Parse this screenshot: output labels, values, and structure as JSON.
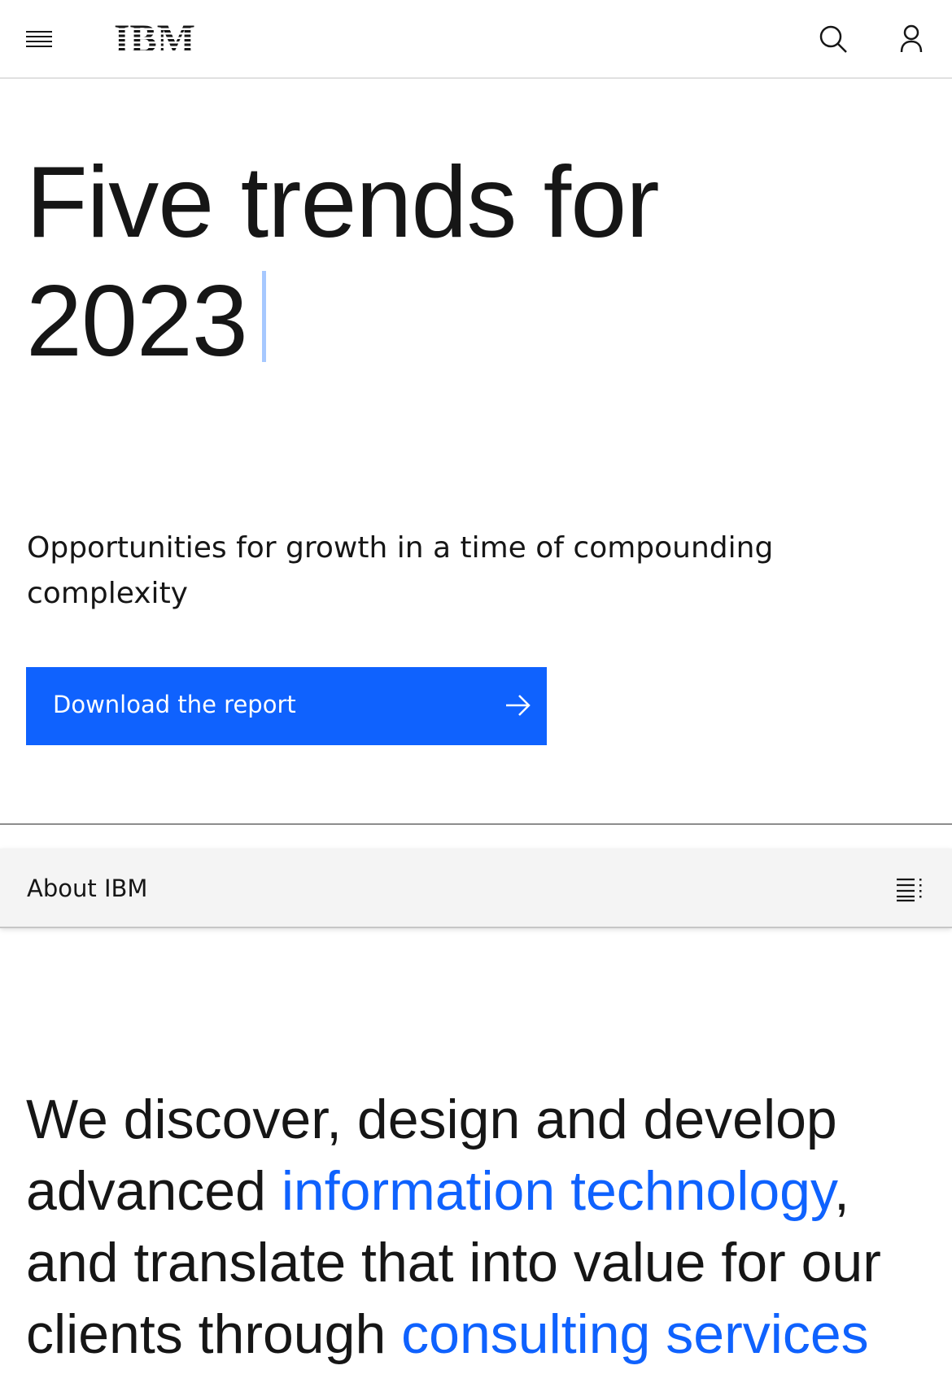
{
  "masthead": {
    "logo_text": "IBM",
    "menu_icon": "hamburger-menu-icon",
    "search_icon": "search-icon",
    "user_icon": "user-profile-icon"
  },
  "hero": {
    "title_line1": "Five trends for",
    "title_line2": "2023",
    "subtitle": "Opportunities for growth in a time of compounding complexity",
    "cta_label": "Download the report",
    "cta_icon": "arrow-right-icon"
  },
  "local_nav": {
    "title": "About IBM",
    "menu_icon": "table-of-contents-icon"
  },
  "intro": {
    "part1": "We discover, design and develop advanced ",
    "link1": "information technology",
    "part2": ", and translate that into value for our clients through ",
    "link2": "consulting services"
  },
  "colors": {
    "brand_blue": "#0f62fe",
    "text": "#161616",
    "nav_background": "#f4f4f4",
    "cursor": "#a6c8ff"
  }
}
